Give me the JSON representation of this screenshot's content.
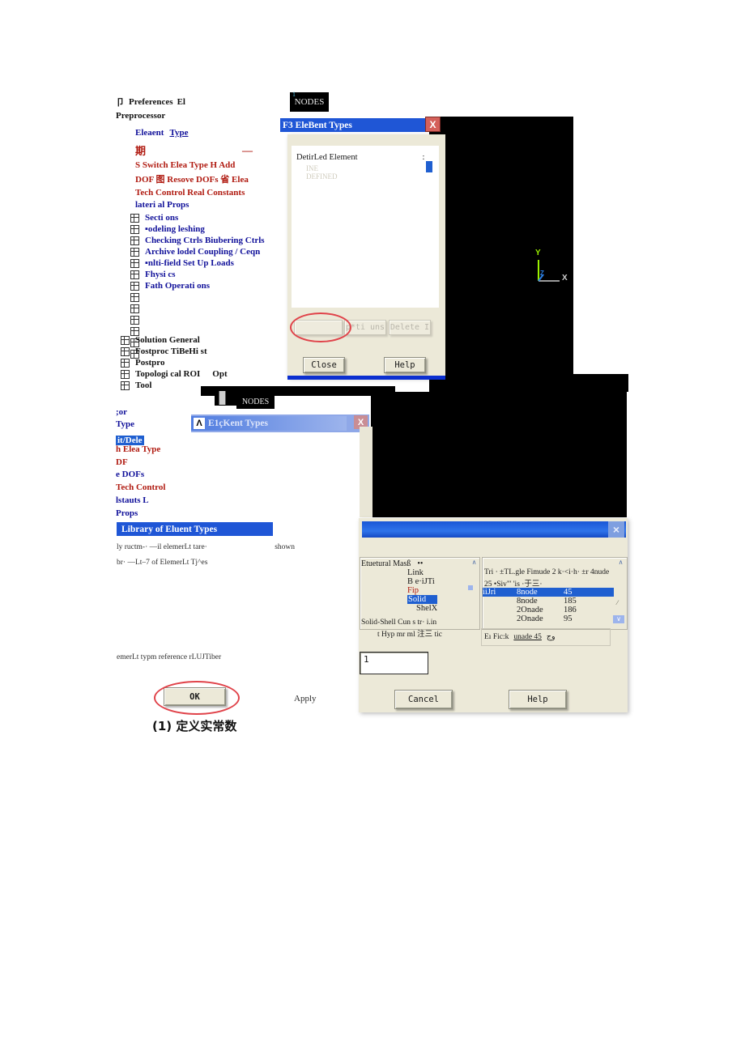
{
  "menu_tree": {
    "top": [
      {
        "label": "Preferences",
        "trail": "El",
        "icon": "list-icon",
        "color": "black"
      },
      {
        "label": "Preprocessor",
        "color": "black"
      }
    ],
    "element_group": [
      {
        "label": "Eleaent",
        "label2": "Type",
        "color": "blue"
      },
      {
        "label": "期",
        "dash": "—",
        "color": "red"
      },
      {
        "label": "S Switch Elea Type H Add",
        "color": "red"
      },
      {
        "label": "DOF 图  Resove DOFs 省  Elea",
        "color": "red"
      },
      {
        "label": "Tech Control Real Constants",
        "color": "red"
      },
      {
        "label": "lateri al Props",
        "color": "blue"
      }
    ],
    "expandables": [
      {
        "label": "Secti ons",
        "bullet": false
      },
      {
        "label": "▪odeling leshing",
        "bullet": false
      },
      {
        "label": "Checking Ctrls Biubering Ctrls",
        "bullet": false
      },
      {
        "label": "Archive lodel Coupling / Ceqn",
        "bullet": false
      },
      {
        "label": "▪nlti-field Set Up Loads",
        "bullet": false
      },
      {
        "label": "Fhysi cs",
        "bullet": false
      },
      {
        "label": "Fath Operati ons",
        "bullet": false
      },
      {
        "label": "",
        "bullet": false
      },
      {
        "label": "",
        "bullet": false
      },
      {
        "label": "",
        "bullet": false
      },
      {
        "label": "",
        "bullet": false
      },
      {
        "label": "",
        "bullet": false
      },
      {
        "label": "",
        "bullet": false
      }
    ],
    "bottom": [
      {
        "label": "Solution General"
      },
      {
        "label": "Fostproc TiBeHi st"
      },
      {
        "label": "Postpro"
      },
      {
        "label": "Topologi cal ROI",
        "trail": "Opt"
      },
      {
        "label": "Tool"
      }
    ]
  },
  "gfx_top": {
    "nodes_label": "NODES",
    "tick_label": "1",
    "triad": {
      "x": "X",
      "y": "Y",
      "z": "Z"
    }
  },
  "dialog_element_types": {
    "title": "F3 EleBent Types",
    "title_prefix": "F3",
    "close_label": "X",
    "list_header": "DetirLed Element",
    "colon": ":",
    "ghost_line1": "INE",
    "ghost_line2": "DEFINED",
    "buttons": {
      "add": "",
      "options": "p*ti uns",
      "delete": "Delete I",
      "close": "Close",
      "help": "Help"
    }
  },
  "menu_tree_2": {
    "items": [
      {
        "label": ";or",
        "color": "blue"
      },
      {
        "label": "Type",
        "color": "blue"
      },
      {
        "label": "it/Dele",
        "color": "blue",
        "highlight": true
      },
      {
        "label": "h Elea Type",
        "color": "red"
      },
      {
        "label": "DF",
        "color": "red"
      },
      {
        "label": "e DOFs",
        "color": "blue"
      },
      {
        "label": "Tech Control",
        "color": "red"
      },
      {
        "label": "lstauts L",
        "color": "blue"
      },
      {
        "label": "Props",
        "color": "blue"
      }
    ]
  },
  "dialog_element_types_2": {
    "title": "E1çKent Types",
    "logo": "ansys-logo-icon",
    "close_label": "X",
    "nodes_label": "NODES"
  },
  "dialog_library": {
    "banner": "Library of Eluent Types",
    "note_line1": "ly ructm-·  —il elemerLt tare·",
    "note_line1_right": "shown",
    "note_line2": "br·  —Lt–7 of ElemerLt Tj^es",
    "note_line3": "emerLt typm reference rLUJTiber",
    "close_label": "×",
    "left_list": {
      "header": "Etuetural Masß",
      "header_tail": "••",
      "scroll_up": "∧",
      "items": [
        {
          "label": "Link"
        },
        {
          "label": "B e·iJTi"
        },
        {
          "label": "Fip",
          "color": "red"
        },
        {
          "label": "Solid",
          "selected": true
        },
        {
          "label": "ShelX"
        }
      ],
      "footer_line1": "Solid-Shell Cun s tr·  i.in",
      "footer_line2": "t Hyp mr ml 注三 tic"
    },
    "right_list": {
      "scroll_up": "∧",
      "header_line1": "Tri ·  ±TL.gle Fimude 2 k·<i·h·  ±r 4nude",
      "header_line2": "25 •Siv\"' 'is ·于三·",
      "rows": [
        {
          "name": "iiJri",
          "nodes": "8node",
          "id": "45",
          "selected": true
        },
        {
          "name": "",
          "nodes": "8node",
          "id": "185"
        },
        {
          "name": "",
          "nodes": "2Onade",
          "id": "186"
        },
        {
          "name": "",
          "nodes": "2Onade",
          "id": "95"
        }
      ],
      "scroll_down": "∨",
      "picker_label": "Eı   Fic:k",
      "picker_value": "unade 45",
      "picker_tail": "وج"
    },
    "type_field_value": "1",
    "buttons": {
      "ok": "OK",
      "apply": "Apply",
      "cancel": "Cancel",
      "help": "Help"
    }
  },
  "annotations": {
    "caption": "(1)  定义实常数",
    "ellipse_ok": "highlight-ok-button",
    "ellipse_add": "highlight-add-button"
  },
  "colors": {
    "titlebar_blue": "#1a57d6",
    "highlight_blue": "#1f5fd0",
    "banner_blue": "#1f56d6",
    "annotation_red": "#e0434a",
    "dialog_face": "#ece9d8",
    "tree_blue": "#11119a",
    "tree_red": "#b01a10"
  }
}
